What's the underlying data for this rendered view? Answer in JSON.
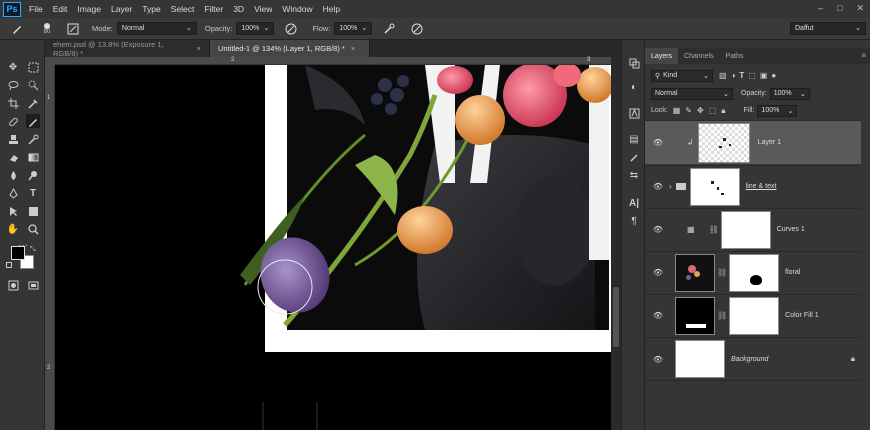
{
  "menubar": {
    "logo": "Ps",
    "items": [
      "File",
      "Edit",
      "Image",
      "Layer",
      "Type",
      "Select",
      "Filter",
      "3D",
      "View",
      "Window",
      "Help"
    ],
    "window_controls": [
      "–",
      "□",
      "✕"
    ]
  },
  "options": {
    "brush_size": "80",
    "mode_label": "Mode:",
    "mode_value": "Normal",
    "opacity_label": "Opacity:",
    "opacity_value": "100%",
    "flow_label": "Flow:",
    "flow_value": "100%",
    "workspace": "Daffut"
  },
  "tabs": [
    {
      "label": "ehem.psd @ 13.8% (Exposure 1, RGB/8) *",
      "active": false
    },
    {
      "label": "Untitled-1 @ 134% (Layer 1, RGB/8) *",
      "active": true
    }
  ],
  "rulers": {
    "top_numbers": [
      "2",
      "3"
    ],
    "left_numbers": [
      "1",
      "2"
    ]
  },
  "panel": {
    "tabs": [
      "Layers",
      "Channels",
      "Paths"
    ],
    "filter_label": "Kind",
    "blend_mode": "Normal",
    "opacity_label": "Opacity:",
    "opacity_value": "100%",
    "lock_label": "Lock:",
    "fill_label": "Fill:",
    "fill_value": "100%",
    "layers": [
      {
        "name": "Layer 1",
        "selected": true,
        "clipped": true
      },
      {
        "name": "line & text",
        "group": true
      },
      {
        "name": "Curves 1",
        "adjustment": true
      },
      {
        "name": "floral"
      },
      {
        "name": "Color Fill 1"
      },
      {
        "name": "Background",
        "locked": true
      }
    ]
  },
  "colors": {
    "accent": "#30a8ff",
    "panel_bg": "#353535",
    "selected_layer": "#5a5a5a"
  }
}
